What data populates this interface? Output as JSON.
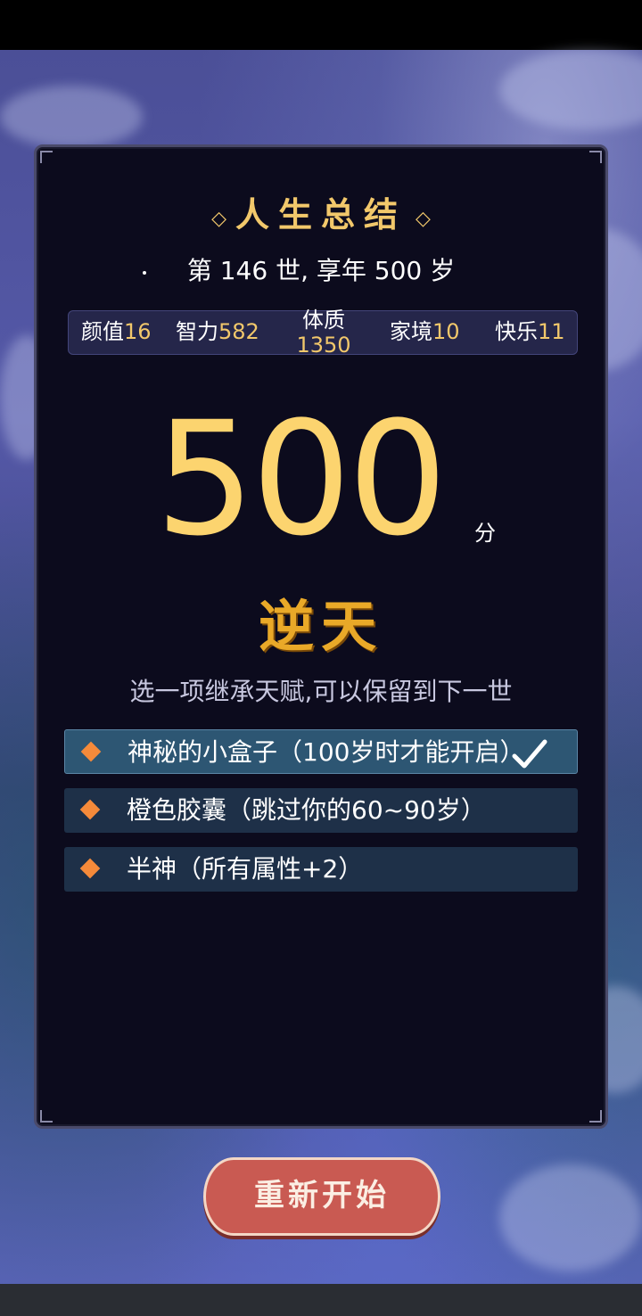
{
  "summary": {
    "title": "人生总结",
    "title_decoration": "◇",
    "life_line": "第 146 世, 享年 500 岁"
  },
  "stats": [
    {
      "label": "颜值",
      "value": "16"
    },
    {
      "label": "智力",
      "value": "582"
    },
    {
      "label": "体质",
      "value": "1350"
    },
    {
      "label": "家境",
      "value": "10"
    },
    {
      "label": "快乐",
      "value": "11"
    }
  ],
  "score": {
    "value": "500",
    "unit": "分",
    "rank": "逆天"
  },
  "inherit": {
    "prompt": "选一项继承天赋,可以保留到下一世",
    "options": [
      {
        "text": "神秘的小盒子（100岁时才能开启）",
        "selected": true
      },
      {
        "text": "橙色胶囊（跳过你的60~90岁）",
        "selected": false
      },
      {
        "text": "半神（所有属性+2）",
        "selected": false
      }
    ]
  },
  "actions": {
    "restart_label": "重新开始"
  },
  "colors": {
    "accent_gold": "#f2c86b",
    "score_gold": "#fcd46f",
    "gem_orange": "#f58a3a",
    "button_red": "#c95a52"
  },
  "icons": {
    "option_bullet": "diamond-icon",
    "selected_mark": "checkmark-icon"
  }
}
